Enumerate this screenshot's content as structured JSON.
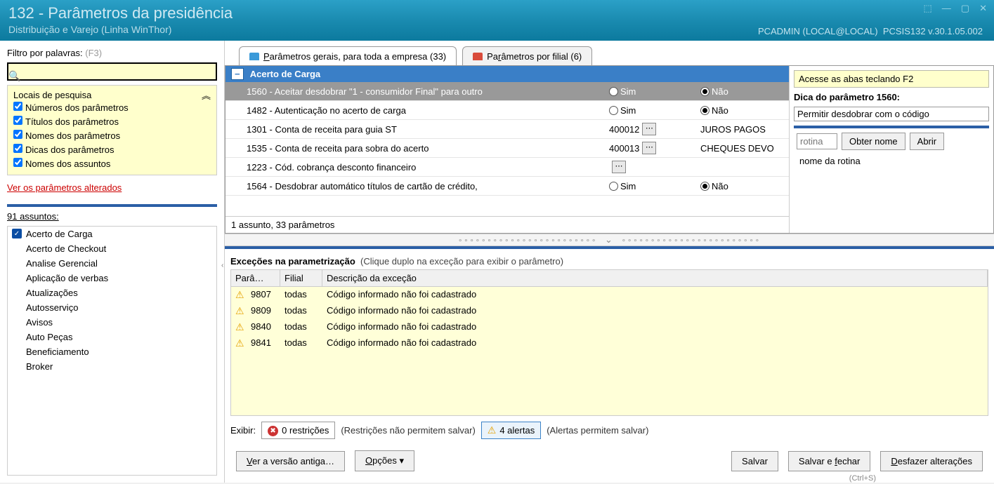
{
  "window": {
    "title": "132 - Parâmetros da presidência",
    "subtitle": "Distribuição e Varejo (Linha WinThor)",
    "user_info": "PCADMIN (LOCAL@LOCAL)",
    "version": "PCSIS132  v.30.1.05.002"
  },
  "left": {
    "filter_label": "Filtro por palavras:",
    "filter_hint": "(F3)",
    "locais_title": "Locais de pesquisa",
    "checks": [
      "Números dos parâmetros",
      "Títulos dos parâmetros",
      "Nomes dos parâmetros",
      "Dicas dos parâmetros",
      "Nomes dos assuntos"
    ],
    "ver_alterados": "Ver os parâmetros alterados",
    "assuntos_label": "91 assuntos:",
    "assuntos": [
      "Acerto de Carga",
      "Acerto de Checkout",
      "Analise Gerencial",
      "Aplicação de verbas",
      "Atualizações",
      "Autosserviço",
      "Avisos",
      "Auto Peças",
      "Beneficiamento",
      "Broker"
    ]
  },
  "tabs": {
    "t1": "Parâmetros gerais, para toda a empresa  (33)",
    "t2": "Parâmetros por filial  (6)"
  },
  "params": {
    "group": "Acerto de Carga",
    "rows": [
      {
        "label": "1560 - Aceitar desdobrar \"1 - consumidor Final\" para outro",
        "type": "radio",
        "value": "Não"
      },
      {
        "label": "1482 - Autenticação no acerto de carga",
        "type": "radio",
        "value": "Não"
      },
      {
        "label": "1301 - Conta de receita para guia ST",
        "type": "lookup",
        "code": "400012",
        "desc": "JUROS PAGOS"
      },
      {
        "label": "1535 - Conta de receita para sobra do acerto",
        "type": "lookup",
        "code": "400013",
        "desc": "CHEQUES DEVO"
      },
      {
        "label": "1223 - Cód. cobrança desconto financeiro",
        "type": "lookup",
        "code": "",
        "desc": ""
      },
      {
        "label": "1564 - Desdobrar automático títulos de cartão de crédito,",
        "type": "radio",
        "value": "Não"
      }
    ],
    "footer": "1 assunto, 33 parâmetros",
    "sim": "Sim",
    "nao": "Não"
  },
  "hint": {
    "access": "Acesse as abas teclando F2",
    "title": "Dica do parâmetro 1560:",
    "body": "Permitir desdobrar com o código",
    "rotina_placeholder": "rotina",
    "obter": "Obter nome",
    "abrir": "Abrir",
    "rotina_name": "nome da rotina"
  },
  "exceptions": {
    "title": "Exceções na parametrização",
    "subtitle": "(Clique duplo na exceção para exibir o parâmetro)",
    "cols": {
      "c1": "Parâ…",
      "c2": "Filial",
      "c3": "Descrição da exceção"
    },
    "rows": [
      {
        "p": "9807",
        "f": "todas",
        "d": "Código informado não foi cadastrado"
      },
      {
        "p": "9809",
        "f": "todas",
        "d": "Código informado não foi cadastrado"
      },
      {
        "p": "9840",
        "f": "todas",
        "d": "Código informado não foi cadastrado"
      },
      {
        "p": "9841",
        "f": "todas",
        "d": "Código informado não foi cadastrado"
      }
    ],
    "exibir": "Exibir:",
    "restricoes": "0 restrições",
    "restricoes_note": "(Restrições não permitem salvar)",
    "alertas": "4 alertas",
    "alertas_note": "(Alertas permitem salvar)"
  },
  "buttons": {
    "ver_versao": "Ver a versão antiga…",
    "opcoes": "Opções ▾",
    "salvar": "Salvar",
    "salvar_fechar": "Salvar e fechar",
    "desfazer": "Desfazer alterações",
    "ctrl_s": "(Ctrl+S)"
  }
}
